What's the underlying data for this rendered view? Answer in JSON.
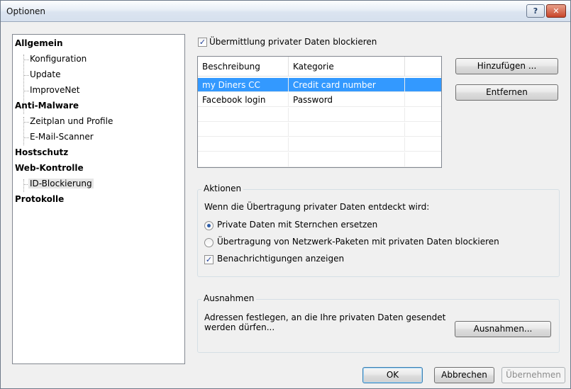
{
  "window": {
    "title": "Optionen",
    "help_label": "?",
    "close_label": "✕"
  },
  "tree": {
    "items": [
      {
        "label": "Allgemein"
      },
      {
        "label": "Konfiguration"
      },
      {
        "label": "Update"
      },
      {
        "label": "ImproveNet"
      },
      {
        "label": "Anti-Malware"
      },
      {
        "label": "Zeitplan und Profile"
      },
      {
        "label": "E-Mail-Scanner"
      },
      {
        "label": "Hostschutz"
      },
      {
        "label": "Web-Kontrolle"
      },
      {
        "label": "ID-Blockierung"
      },
      {
        "label": "Protokolle"
      }
    ]
  },
  "block_private_data": {
    "label": "Übermittlung privater Daten blockieren",
    "checked": true
  },
  "table": {
    "columns": [
      "Beschreibung",
      "Kategorie"
    ],
    "rows": [
      {
        "description": "my Diners CC",
        "category": "Credit card number",
        "selected": true
      },
      {
        "description": "Facebook login",
        "category": "Password",
        "selected": false
      }
    ]
  },
  "buttons": {
    "add": "Hinzufügen ...",
    "remove": "Entfernen"
  },
  "actions": {
    "title": "Aktionen",
    "prompt": "Wenn die Übertragung privater Daten entdeckt wird:",
    "option_replace": "Private Daten mit Sternchen ersetzen",
    "option_block": "Übertragung von Netzwerk-Paketen mit privaten Daten blockieren",
    "selected_option": "option_replace",
    "notify_label": "Benachrichtigungen anzeigen",
    "notify_checked": true
  },
  "exceptions": {
    "title": "Ausnahmen",
    "description_line1": "Adressen festlegen, an die Ihre privaten Daten gesendet",
    "description_line2": "werden dürfen...",
    "button": "Ausnahmen..."
  },
  "footer": {
    "ok": "OK",
    "cancel": "Abbrechen",
    "apply": "Übernehmen"
  },
  "colors": {
    "selection": "#3399ff",
    "titlebar": "#dbe4f0",
    "accent": "#2d5da8"
  }
}
